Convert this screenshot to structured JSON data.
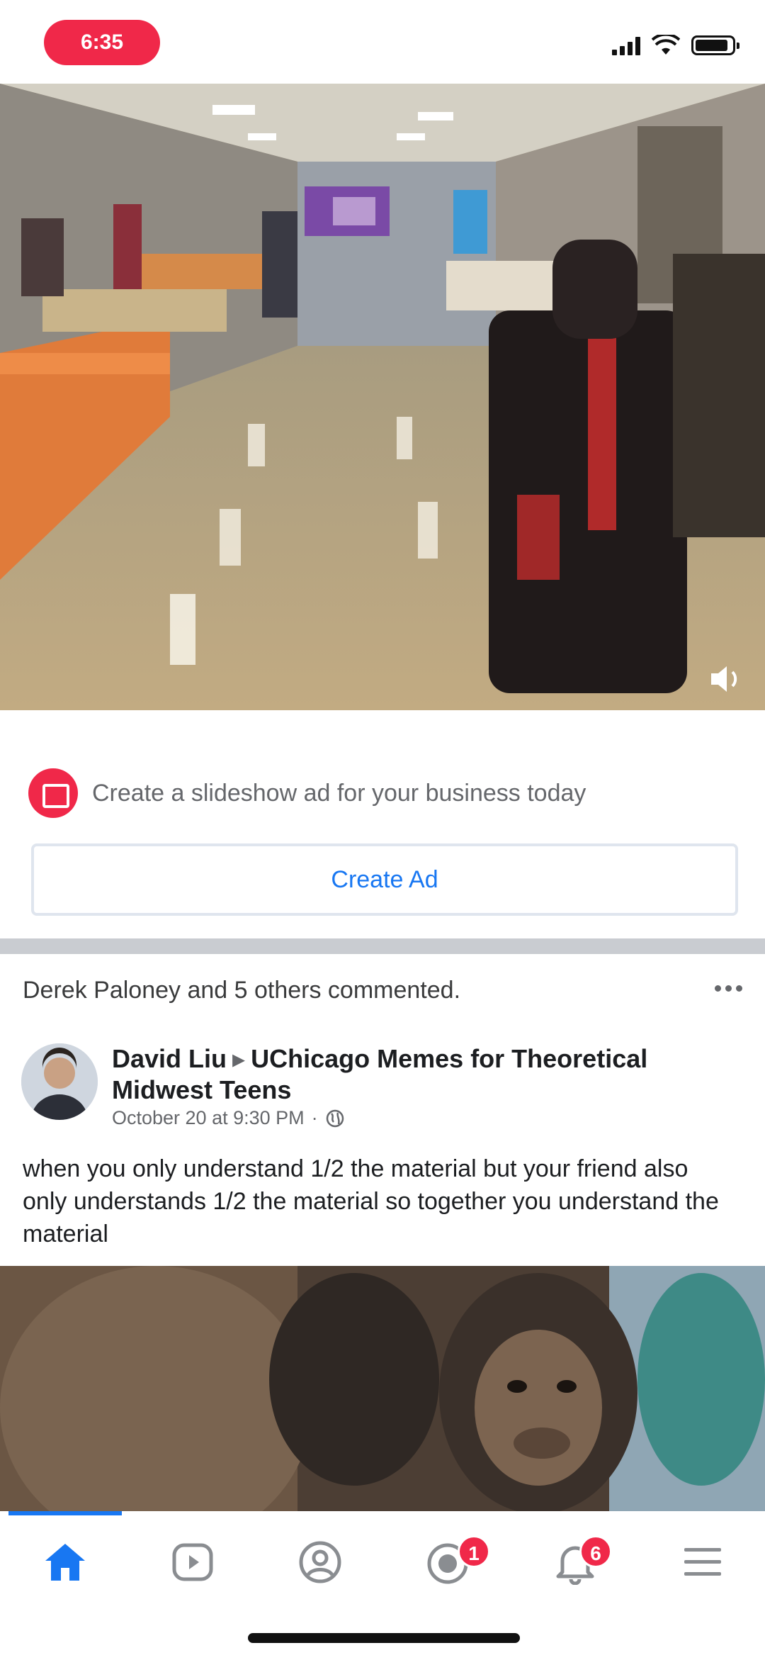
{
  "status_bar": {
    "time": "6:35"
  },
  "ad_prompt": {
    "text": "Create a slideshow ad for your business today",
    "button_label": "Create Ad"
  },
  "post": {
    "activity": "Derek Paloney and 5 others commented.",
    "author": "David Liu",
    "group": "UChicago Memes for Theoretical Midwest Teens",
    "timestamp": "October 20 at 9:30 PM",
    "text": "when you only understand 1/2 the material but your friend also only understands 1/2 the material so together you understand the material"
  },
  "tab_bar": {
    "tabs": [
      {
        "name": "home",
        "icon": "home-icon",
        "active": true
      },
      {
        "name": "watch",
        "icon": "watch-icon",
        "active": false
      },
      {
        "name": "profile",
        "icon": "profile-icon",
        "active": false
      },
      {
        "name": "groups",
        "icon": "groups-icon",
        "badge": "1",
        "active": false
      },
      {
        "name": "notifications",
        "icon": "bell-icon",
        "badge": "6",
        "active": false
      },
      {
        "name": "menu",
        "icon": "menu-icon",
        "active": false
      }
    ]
  },
  "colors": {
    "accent": "#1877f2",
    "badge": "#f02849",
    "separator": "#c9ccd1"
  }
}
